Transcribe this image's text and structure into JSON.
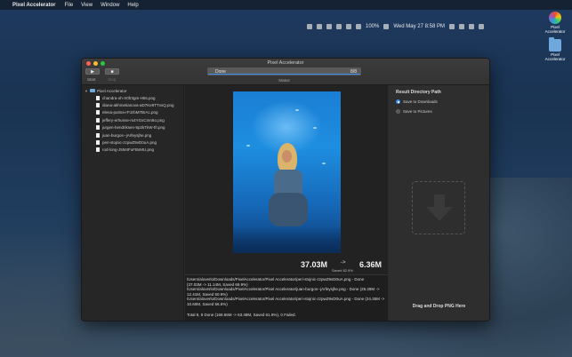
{
  "menubar": {
    "apple": "",
    "app_name": "Pixel Accelerator",
    "items": [
      "File",
      "View",
      "Window",
      "Help"
    ],
    "battery": "100%",
    "clock": "Wed May 27  8:58 PM"
  },
  "desktop": {
    "icons": [
      {
        "label": "Pixel\nAccelerator"
      },
      {
        "label": "Pixel\nAccelerator"
      }
    ]
  },
  "window": {
    "title": "Pixel Accelerator",
    "toolbar": {
      "start_label": "Start",
      "stop_label": "Stop",
      "play_glyph": "▶",
      "stop_glyph": "■"
    },
    "status": {
      "text": "Done",
      "count": "8/8",
      "progress": 1.0,
      "label": "Status"
    }
  },
  "sidebar": {
    "root": "Pixel Accelerator",
    "files": [
      "chandra-oh-X0fr3gm-H8s.png",
      "diana-akhmetianova-aD7Ke9TTxsQ.png",
      "elena-putina-rPJzbM7BrAc.png",
      "jeffery-erhunse-rs4YGsCmn8o.png",
      "jurgen-hendriksen-5p2kTkW-tfI.png",
      "juan-burgos--jArfeysjhe.png",
      "peri-stojnic-zzpwZ9vD0uA.png",
      "rod-long-J5M4FuFBsMU.png"
    ]
  },
  "preview": {
    "original_size": "37.03M",
    "new_size": "6.36M",
    "arrow": "->",
    "saved": "Saved 82.9%"
  },
  "log": {
    "lines": [
      "/Users/aloverlo/Downloads/PixelAccelerator/Pixel Accelerator/peri-stojnic-zzpwZ9vD0uA.png - Done",
      "(37.03M -> 11.14M, Saved 69.9%)",
      "/Users/aloverlo/Downloads/PixelAccelerator/Pixel Accelerator/juan-burgos--jArfeysjhe.png - Done (25.28M ->",
      "12.41M, Saved 50.9%)",
      "/Users/aloverlo/Downloads/PixelAccelerator/Pixel Accelerator/peri-stojnic-zzpwZ9vD0uA.png - Done (24.35M ->",
      "10.60M, Saved 56.5%)"
    ],
    "total": "Total 8,  8 Done (168.66M -> 63.48M, Saved 61.9%), 0 Failed."
  },
  "right_panel": {
    "title": "Result Directory Path",
    "options": [
      "Save to Downloads",
      "Save to Pictures"
    ],
    "selected": 0,
    "drop_label": "Drag and Drop PNG Here"
  },
  "colors": {
    "accent": "#3b8ff6",
    "window_bg": "#2b2b2b"
  }
}
